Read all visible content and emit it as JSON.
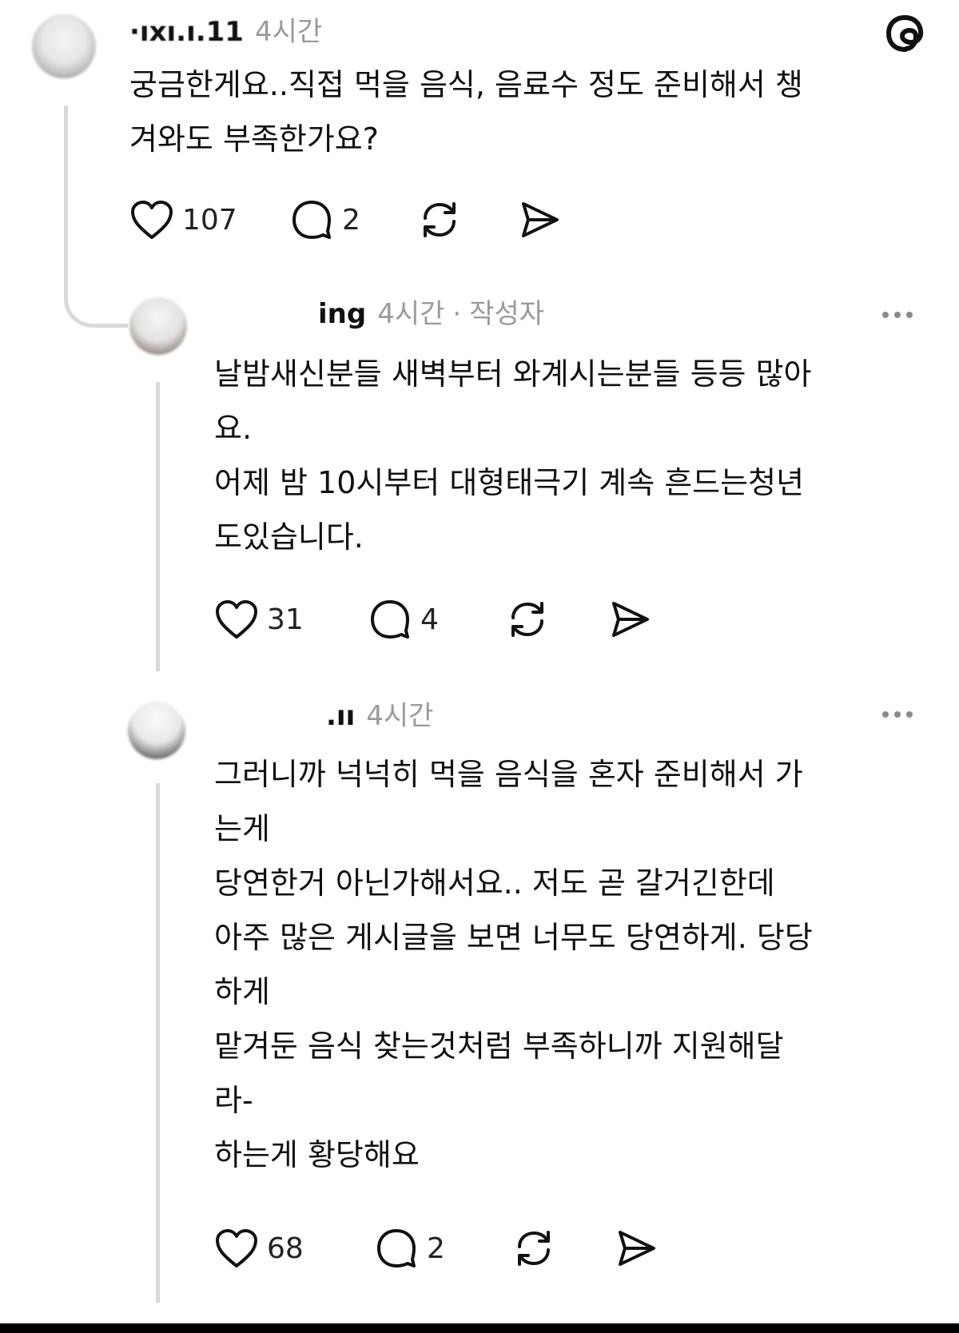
{
  "app": {
    "logo_icon": "threads-logo-icon"
  },
  "posts": [
    {
      "username": "·ıxı.ı.11",
      "time": "4시간",
      "author_badge": "",
      "lines": [
        "궁금한게요..직접 먹을 음식, 음료수 정도 준비해서 챙",
        "겨와도 부족한가요?"
      ],
      "likes": "107",
      "replies": "2"
    },
    {
      "username": "ing",
      "time": "4시간",
      "separator": "·",
      "author_badge": "작성자",
      "lines": [
        "날밤새신분들 새벽부터 와계시는분들 등등 많아",
        "요.",
        "어제 밤 10시부터 대형태극기 계속 흔드는청년",
        "도있습니다."
      ],
      "likes": "31",
      "replies": "4"
    },
    {
      "username": ".ıı",
      "time": "4시간",
      "author_badge": "",
      "lines": [
        "그러니까 넉넉히 먹을 음식을 혼자 준비해서 가",
        "는게",
        "당연한거 아닌가해서요.. 저도 곧 갈거긴한데",
        "아주 많은 게시글을 보면 너무도 당연하게. 당당",
        "하게",
        "맡겨둔 음식 찾는것처럼 부족하니까 지원해달",
        "라-",
        "하는게 황당해요"
      ],
      "likes": "68",
      "replies": "2"
    }
  ],
  "icons": {
    "like": "heart-icon",
    "reply": "comment-icon",
    "repost": "repost-icon",
    "share": "send-icon",
    "more": "more-dots-icon"
  }
}
